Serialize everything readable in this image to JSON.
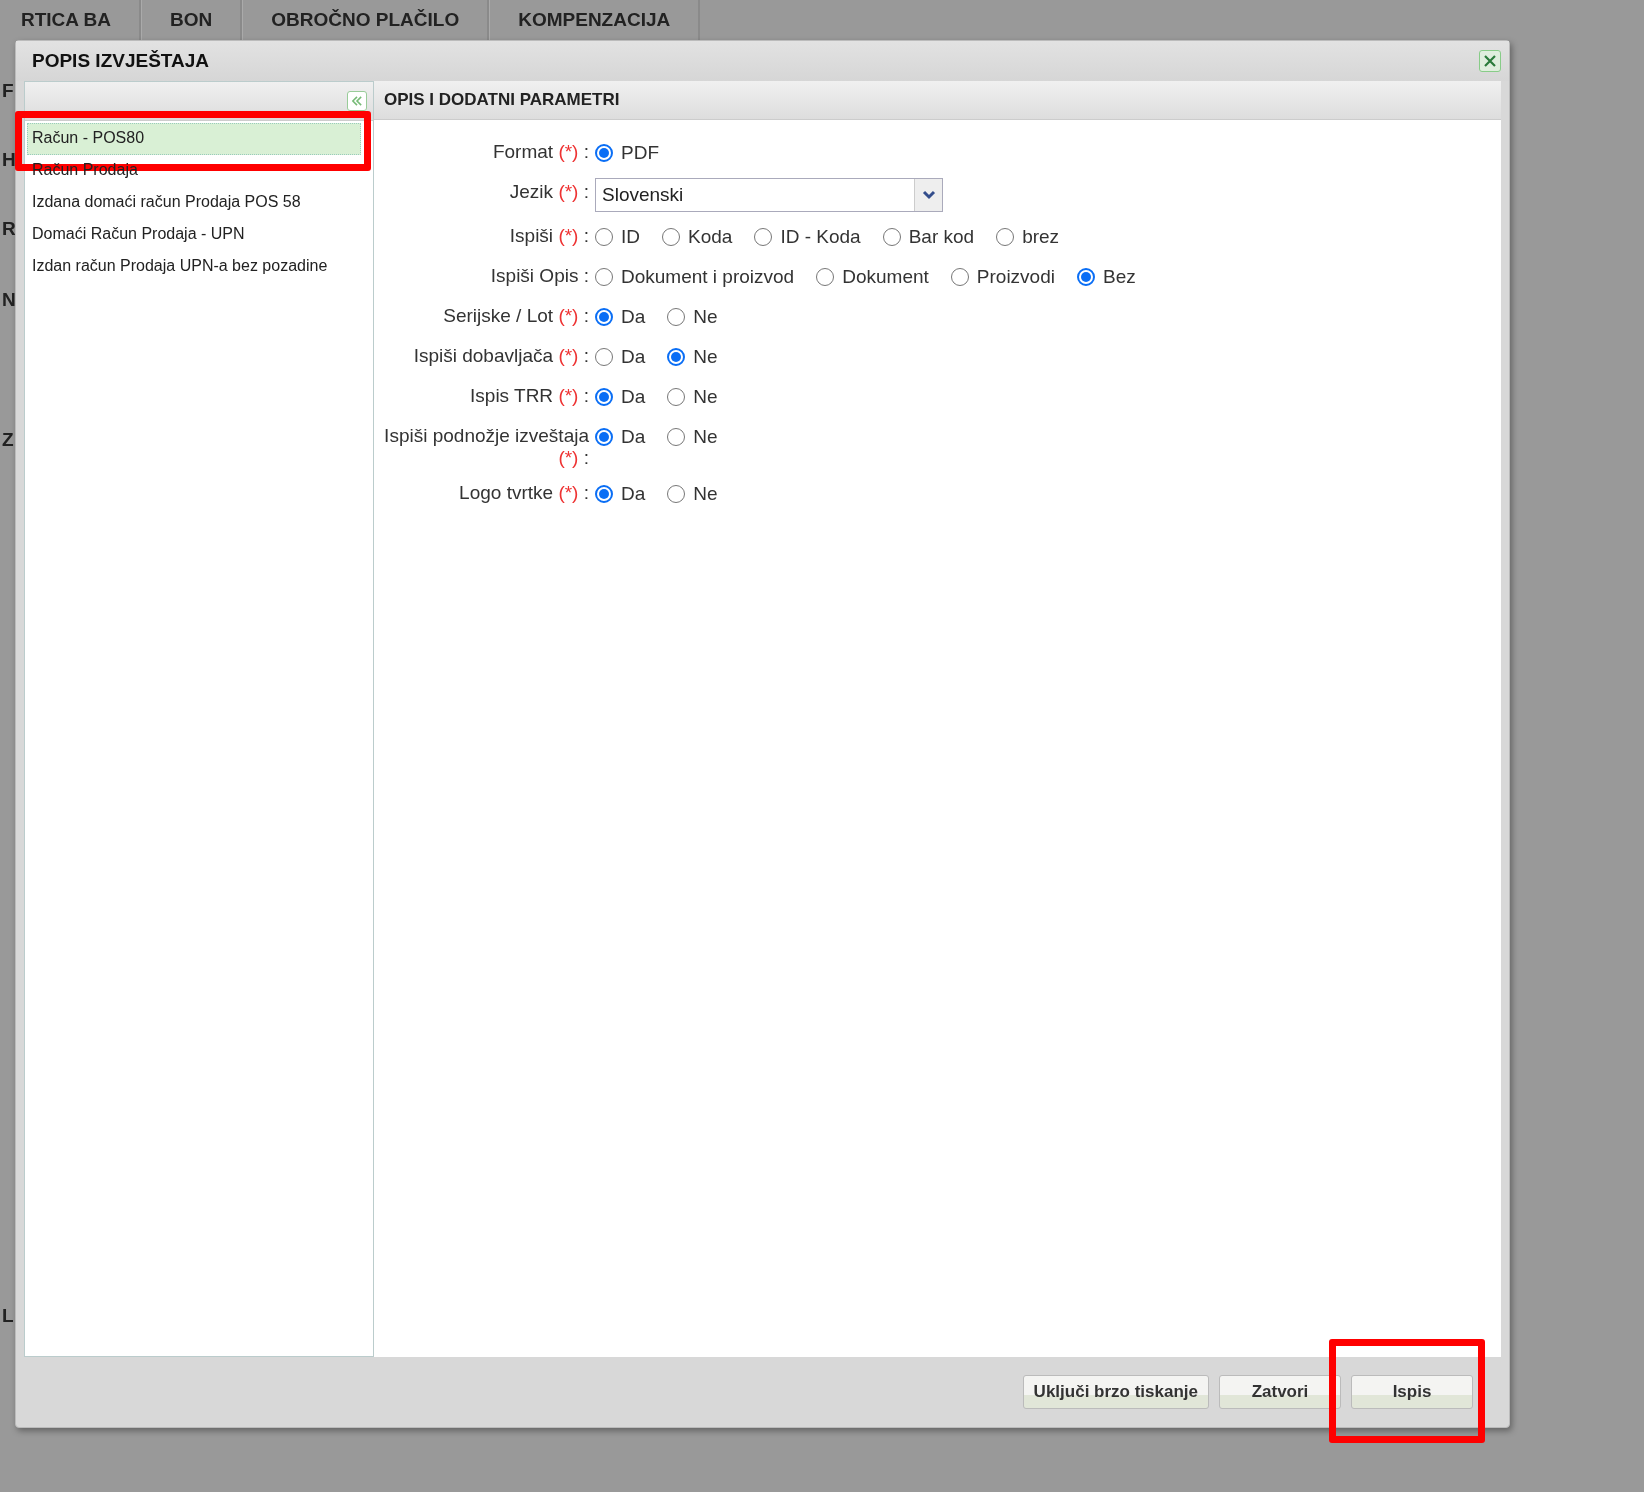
{
  "background_tabs": [
    "RTICA BA",
    "BON",
    "OBROČNO PLAČILO",
    "KOMPENZACIJA"
  ],
  "left_edge_labels": [
    "F",
    "H",
    "R",
    "N",
    "Z",
    "L"
  ],
  "dialog": {
    "title": "POPIS IZVJEŠTAJA",
    "reports": [
      {
        "label": "Račun - POS80",
        "selected": true,
        "highlighted": true
      },
      {
        "label": "Račun Prodaja",
        "selected": false,
        "highlighted": false
      },
      {
        "label": "Izdana domaći račun Prodaja POS 58",
        "selected": false,
        "highlighted": false
      },
      {
        "label": "Domaći Račun Prodaja - UPN",
        "selected": false,
        "highlighted": false
      },
      {
        "label": "Izdan račun Prodaja UPN-a bez pozadine",
        "selected": false,
        "highlighted": false
      }
    ],
    "panel_title": "OPIS I DODATNI PARAMETRI",
    "fields": [
      {
        "kind": "radio",
        "label": "Format",
        "required_mark": "(*)",
        "separator": ":",
        "options": [
          {
            "label": "PDF",
            "selected": true
          }
        ]
      },
      {
        "kind": "select",
        "label": "Jezik",
        "required_mark": "(*)",
        "separator": ":",
        "value": "Slovenski"
      },
      {
        "kind": "radio",
        "label": "Ispiši",
        "required_mark": "(*)",
        "separator": ":",
        "options": [
          {
            "label": "ID",
            "selected": false
          },
          {
            "label": "Koda",
            "selected": false
          },
          {
            "label": "ID - Koda",
            "selected": false
          },
          {
            "label": "Bar kod",
            "selected": false
          },
          {
            "label": "brez",
            "selected": false
          }
        ]
      },
      {
        "kind": "radio",
        "label": "Ispiši Opis",
        "separator": ":",
        "options": [
          {
            "label": "Dokument i proizvod",
            "selected": false
          },
          {
            "label": "Dokument",
            "selected": false
          },
          {
            "label": "Proizvodi",
            "selected": false
          },
          {
            "label": "Bez",
            "selected": true
          }
        ]
      },
      {
        "kind": "radio",
        "label": "Serijske / Lot",
        "required_mark": "(*)",
        "separator": ":",
        "options": [
          {
            "label": "Da",
            "selected": true
          },
          {
            "label": "Ne",
            "selected": false
          }
        ]
      },
      {
        "kind": "radio",
        "label": "Ispiši dobavljača",
        "required_mark": "(*)",
        "separator": ":",
        "options": [
          {
            "label": "Da",
            "selected": false
          },
          {
            "label": "Ne",
            "selected": true
          }
        ]
      },
      {
        "kind": "radio",
        "label": "Ispis TRR",
        "required_mark": "(*)",
        "separator": ":",
        "options": [
          {
            "label": "Da",
            "selected": true
          },
          {
            "label": "Ne",
            "selected": false
          }
        ]
      },
      {
        "kind": "radio",
        "label": "Ispiši podnožje izveštaja",
        "required_mark": "(*)",
        "separator": ":",
        "options": [
          {
            "label": "Da",
            "selected": true
          },
          {
            "label": "Ne",
            "selected": false
          }
        ]
      },
      {
        "kind": "radio",
        "label": "Logo tvrtke",
        "required_mark": "(*)",
        "separator": ":",
        "options": [
          {
            "label": "Da",
            "selected": true
          },
          {
            "label": "Ne",
            "selected": false
          }
        ]
      }
    ],
    "buttons": [
      {
        "label": "Uključi brzo tiskanje",
        "highlighted": false
      },
      {
        "label": "Zatvori",
        "highlighted": false
      },
      {
        "label": "Ispis",
        "highlighted": true
      }
    ]
  }
}
